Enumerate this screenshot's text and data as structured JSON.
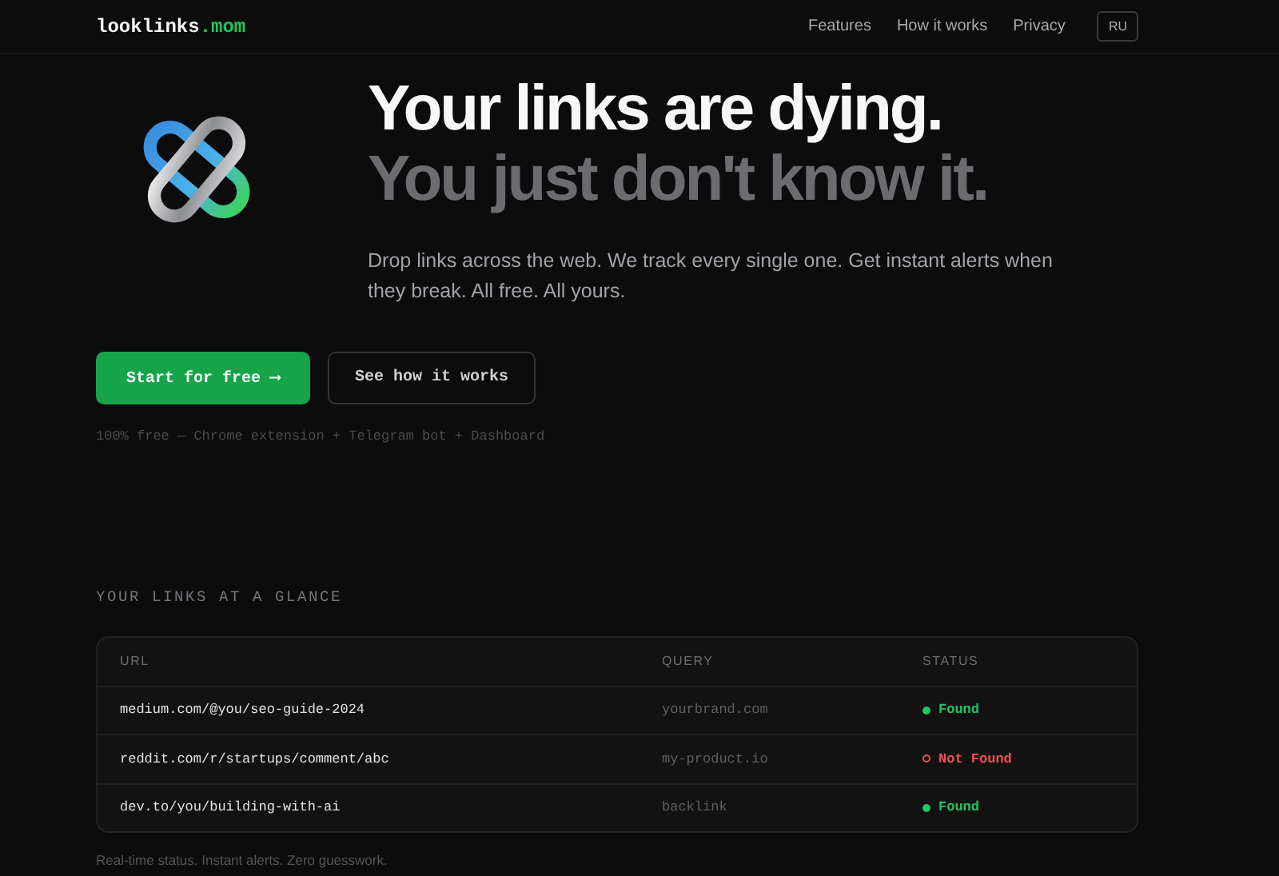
{
  "brand": {
    "name": "looklinks",
    "tld": ".mom"
  },
  "nav": {
    "links": [
      "Features",
      "How it works",
      "Privacy"
    ],
    "language": "RU"
  },
  "hero": {
    "headline": "Your links are dying.",
    "subheadline": "You just don't know it.",
    "description": "Drop links across the web. We track every single one. Get instant alerts when they break. All free. All yours.",
    "primary_button": "Start for free ⟶",
    "secondary_button": "See how it works",
    "note": "100% free — Chrome extension + Telegram bot + Dashboard"
  },
  "glance": {
    "heading": "YOUR LINKS AT A GLANCE",
    "table": {
      "columns": [
        "URL",
        "QUERY",
        "STATUS"
      ],
      "rows": [
        {
          "url": "medium.com/@you/seo-guide-2024",
          "query": "yourbrand.com",
          "status": "Found",
          "kind": "found"
        },
        {
          "url": "reddit.com/r/startups/comment/abc",
          "query": "my-product.io",
          "status": "Not Found",
          "kind": "not_found"
        },
        {
          "url": "dev.to/you/building-with-ai",
          "query": "backlink",
          "status": "Found",
          "kind": "found"
        }
      ]
    },
    "caption": "Real-time status. Instant alerts. Zero guesswork."
  }
}
